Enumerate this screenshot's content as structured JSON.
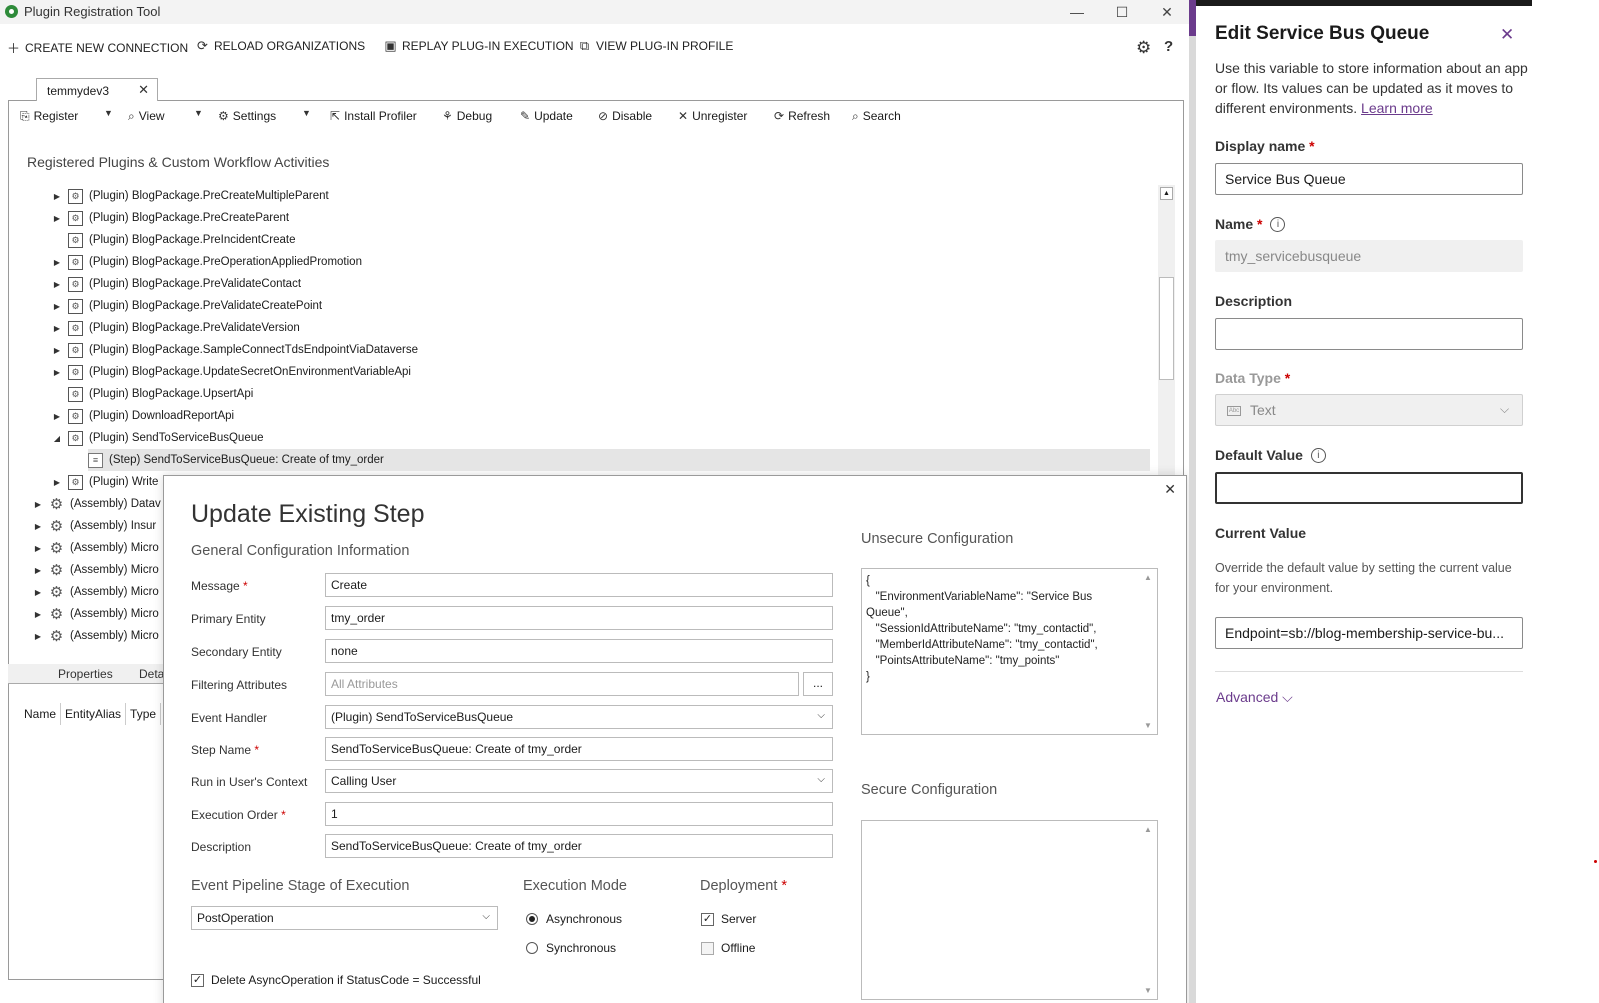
{
  "window": {
    "title": "Plugin Registration Tool",
    "controls": {
      "minimize": "—",
      "maximize": "☐",
      "close": "✕"
    }
  },
  "command_bar": {
    "create_connection": "CREATE NEW CONNECTION",
    "reload_orgs": "RELOAD ORGANIZATIONS",
    "replay": "REPLAY PLUG-IN EXECUTION",
    "view_profile": "VIEW PLUG-IN PROFILE"
  },
  "tab": {
    "label": "temmydev3",
    "close": "✕"
  },
  "toolbar": {
    "register": "Register",
    "view": "View",
    "settings": "Settings",
    "install_profiler": "Install Profiler",
    "debug": "Debug",
    "update": "Update",
    "disable": "Disable",
    "unregister": "Unregister",
    "refresh": "Refresh",
    "search": "Search"
  },
  "tree": {
    "title": "Registered Plugins & Custom Workflow Activities",
    "items": [
      {
        "text": "(Plugin) BlogPackage.PreCreateMultipleParent",
        "expander": "▶",
        "kind": "plugin"
      },
      {
        "text": "(Plugin) BlogPackage.PreCreateParent",
        "expander": "▶",
        "kind": "plugin"
      },
      {
        "text": "(Plugin) BlogPackage.PreIncidentCreate",
        "expander": "",
        "kind": "plugin"
      },
      {
        "text": "(Plugin) BlogPackage.PreOperationAppliedPromotion",
        "expander": "▶",
        "kind": "plugin"
      },
      {
        "text": "(Plugin) BlogPackage.PreValidateContact",
        "expander": "▶",
        "kind": "plugin"
      },
      {
        "text": "(Plugin) BlogPackage.PreValidateCreatePoint",
        "expander": "▶",
        "kind": "plugin"
      },
      {
        "text": "(Plugin) BlogPackage.PreValidateVersion",
        "expander": "▶",
        "kind": "plugin"
      },
      {
        "text": "(Plugin) BlogPackage.SampleConnectTdsEndpointViaDataverse",
        "expander": "▶",
        "kind": "plugin"
      },
      {
        "text": "(Plugin) BlogPackage.UpdateSecretOnEnvironmentVariableApi",
        "expander": "▶",
        "kind": "plugin"
      },
      {
        "text": "(Plugin) BlogPackage.UpsertApi",
        "expander": "",
        "kind": "plugin"
      },
      {
        "text": "(Plugin) DownloadReportApi",
        "expander": "▶",
        "kind": "plugin"
      },
      {
        "text": "(Plugin) SendToServiceBusQueue",
        "expander": "◢",
        "kind": "plugin"
      },
      {
        "text": "(Step) SendToServiceBusQueue: Create of tmy_order",
        "expander": "",
        "kind": "step"
      },
      {
        "text": "(Plugin) Write",
        "expander": "▶",
        "kind": "plugin"
      },
      {
        "text": "(Assembly) Datav",
        "expander": "▶",
        "kind": "assembly"
      },
      {
        "text": "(Assembly) Insur",
        "expander": "▶",
        "kind": "assembly"
      },
      {
        "text": "(Assembly) Micro",
        "expander": "▶",
        "kind": "assembly"
      },
      {
        "text": "(Assembly) Micro",
        "expander": "▶",
        "kind": "assembly"
      },
      {
        "text": "(Assembly) Micro",
        "expander": "▶",
        "kind": "assembly"
      },
      {
        "text": "(Assembly) Micro",
        "expander": "▶",
        "kind": "assembly"
      },
      {
        "text": "(Assembly) Micro",
        "expander": "▶",
        "kind": "assembly"
      }
    ]
  },
  "bottom": {
    "tabs": [
      "Properties",
      "Deta"
    ],
    "columns": [
      "Name",
      "EntityAlias",
      "Type"
    ]
  },
  "dialog": {
    "title": "Update Existing Step",
    "general_header": "General Configuration Information",
    "fields": {
      "message": {
        "label": "Message",
        "value": "Create"
      },
      "primary_entity": {
        "label": "Primary Entity",
        "value": "tmy_order"
      },
      "secondary_entity": {
        "label": "Secondary Entity",
        "value": "none"
      },
      "filtering_attributes": {
        "label": "Filtering Attributes",
        "placeholder": "All Attributes",
        "button": "..."
      },
      "event_handler": {
        "label": "Event Handler",
        "value": "(Plugin) SendToServiceBusQueue"
      },
      "step_name": {
        "label": "Step Name",
        "value": "SendToServiceBusQueue: Create of tmy_order"
      },
      "run_context": {
        "label": "Run in User's Context",
        "value": "Calling User"
      },
      "execution_order": {
        "label": "Execution Order",
        "value": "1"
      },
      "description": {
        "label": "Description",
        "value": "SendToServiceBusQueue: Create of tmy_order"
      }
    },
    "pipeline": {
      "header": "Event Pipeline Stage of Execution",
      "value": "PostOperation"
    },
    "execution_mode": {
      "header": "Execution Mode",
      "options": [
        "Asynchronous",
        "Synchronous"
      ],
      "selected": "Asynchronous"
    },
    "deployment": {
      "header": "Deployment",
      "server": "Server",
      "offline": "Offline",
      "server_checked": true,
      "offline_checked": false
    },
    "delete_async": {
      "label": "Delete AsyncOperation if StatusCode = Successful",
      "checked": true
    },
    "unsecure_header": "Unsecure  Configuration",
    "unsecure_value": "{\n   \"EnvironmentVariableName\": \"Service Bus Queue\",\n   \"SessionIdAttributeName\": \"tmy_contactid\",\n   \"MemberIdAttributeName\": \"tmy_contactid\",\n   \"PointsAttributeName\": \"tmy_points\"\n}",
    "secure_header": "Secure  Configuration",
    "secure_value": ""
  },
  "panel": {
    "title": "Edit Service Bus Queue",
    "description": "Use this variable to store information about an app or flow. Its values can be updated as it moves to different environments.",
    "learn_more": "Learn more",
    "display_name_label": "Display name",
    "display_name_value": "Service Bus Queue",
    "name_label": "Name",
    "name_value": "tmy_servicebusqueue",
    "description_label": "Description",
    "description_value": "",
    "data_type_label": "Data Type",
    "data_type_value": "Text",
    "default_value_label": "Default Value",
    "default_value": "",
    "current_value_label": "Current Value",
    "current_value_help": "Override the default value by setting the current value for your environment.",
    "current_value": "Endpoint=sb://blog-membership-service-bu...",
    "advanced": "Advanced",
    "accent_color": "#6b3b8c"
  }
}
